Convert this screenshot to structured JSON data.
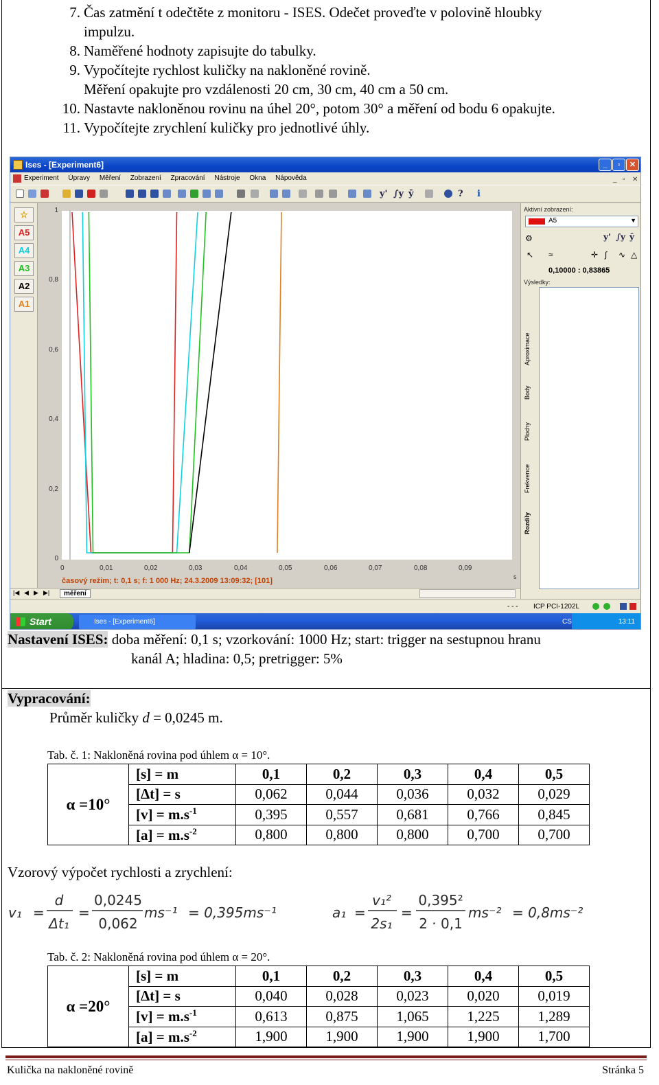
{
  "steps": [
    {
      "num": "7.",
      "text": "Čas zatmění t odečtěte z monitoru - ISES. Odečet proveďte v polovině hloubky"
    },
    {
      "num": "",
      "text": "impulzu."
    },
    {
      "num": "8.",
      "text": "Naměřené hodnoty zapisujte do tabulky."
    },
    {
      "num": "9.",
      "text": "Vypočítejte rychlost kuličky na nakloněné rovině."
    },
    {
      "num": "",
      "text": "Měření opakujte pro vzdálenosti 20 cm, 30 cm, 40 cm a 50 cm."
    },
    {
      "num": "10.",
      "text": "Nastavte nakloněnou rovinu na úhel 20°, potom 30° a měření od bodu 6 opakujte."
    },
    {
      "num": "11.",
      "text": "Vypočítejte zrychlení kuličky pro jednotlivé úhly."
    }
  ],
  "screenshot": {
    "title": "Ises - [Experiment6]",
    "menu": [
      "Experiment",
      "Úpravy",
      "Měření",
      "Zobrazení",
      "Zpracování",
      "Nástroje",
      "Okna",
      "Nápověda"
    ],
    "toolbar_text": [
      "y'",
      "∫y",
      "ȳ"
    ],
    "channels": [
      "A5",
      "A4",
      "A3",
      "A2",
      "A1"
    ],
    "channel_colors": [
      "#e02020",
      "#10d0e0",
      "#20c020",
      "#000000",
      "#e08020"
    ],
    "status_line": "časový režim; t: 0,1 s; f: 1 000 Hz; 24.3.2009 13:09:32; [101]",
    "tab_label": "měření",
    "x_unit": "s",
    "right_panel": {
      "active_label": "Aktivní zobrazení:",
      "active_value": "A5",
      "tool_text": [
        "y'",
        "∫y",
        "ȳ"
      ],
      "readout": "0,10000 : 0,83865",
      "results_label": "Výsledky:",
      "vertical_tabs": [
        "Aproximace",
        "Body",
        "Plochy",
        "Frekvence",
        "Rozdíly"
      ]
    },
    "status_bar": {
      "left": "- - -",
      "device": "ICP PCI-1202L"
    },
    "taskbar": {
      "start": "Start",
      "task": "Ises - [Experiment6]",
      "lang": "CS",
      "clock": "13:11"
    }
  },
  "chart_data": {
    "type": "line",
    "title": "",
    "xlabel": "",
    "ylabel": "",
    "x_unit": "s",
    "xlim": [
      0,
      0.1
    ],
    "ylim": [
      0,
      1
    ],
    "x_ticks": [
      "0",
      "0,01",
      "0,02",
      "0,03",
      "0,04",
      "0,05",
      "0,06",
      "0,07",
      "0,08",
      "0,09"
    ],
    "y_ticks": [
      "1",
      "0,8",
      "0,6",
      "0,4",
      "0,2",
      "0"
    ],
    "series": [
      {
        "name": "A5",
        "color": "#e02020",
        "points": [
          [
            0.0005,
            1
          ],
          [
            0.005,
            0
          ],
          [
            0.0245,
            0
          ],
          [
            0.0255,
            1
          ]
        ]
      },
      {
        "name": "A4",
        "color": "#10d0e0",
        "points": [
          [
            0.003,
            1
          ],
          [
            0.004,
            0
          ],
          [
            0.0255,
            0
          ],
          [
            0.0305,
            1
          ]
        ]
      },
      {
        "name": "A3",
        "color": "#20c020",
        "points": [
          [
            0.0045,
            1
          ],
          [
            0.0055,
            0
          ],
          [
            0.0285,
            0
          ],
          [
            0.0325,
            1
          ]
        ]
      },
      {
        "name": "A2",
        "color": "#000000",
        "points": [
          [
            0.0285,
            0
          ],
          [
            0.0385,
            1
          ]
        ]
      },
      {
        "name": "A1",
        "color": "#e08020",
        "points": [
          [
            0.0495,
            0
          ],
          [
            0.0505,
            1
          ]
        ]
      }
    ]
  },
  "settings": {
    "label": "Nastavení ISES:",
    "line1": "doba měření: 0,1 s; vzorkování: 1000 Hz; start: trigger na sestupnou hranu",
    "line2": "kanál A; hladina: 0,5;  pretrigger: 5%"
  },
  "processing": {
    "label": "Vypracování:",
    "diameter_prefix": "Průměr kuličky ",
    "diameter_var": "d",
    "diameter_value": " = 0,0245 m."
  },
  "table1": {
    "caption": "Tab. č. 1: Nakloněná rovina pod úhlem α = 10°.",
    "alpha": "α =10°",
    "header": [
      "0,1",
      "0,2",
      "0,3",
      "0,4",
      "0,5"
    ],
    "rows": [
      {
        "qty": "[s] = m",
        "values": [
          "0,1",
          "0,2",
          "0,3",
          "0,4",
          "0,5"
        ]
      },
      {
        "qty": "[Δt] = s",
        "values": [
          "0,062",
          "0,044",
          "0,036",
          "0,032",
          "0,029"
        ]
      },
      {
        "qty": "[v] = m.s",
        "exp": "-1",
        "values": [
          "0,395",
          "0,557",
          "0,681",
          "0,766",
          "0,845"
        ]
      },
      {
        "qty": "[a] = m.s",
        "exp": "-2",
        "values": [
          "0,800",
          "0,800",
          "0,800",
          "0,700",
          "0,700"
        ]
      }
    ]
  },
  "example_heading": "Vzorový výpočet rychlosti a zrychlení:",
  "formula_v": {
    "lhs": "v₁",
    "n1": "d",
    "d1": "Δt₁",
    "n2": "0,0245",
    "d2": "0,062",
    "unit": "ms⁻¹",
    "result": "= 0,395ms⁻¹"
  },
  "formula_a": {
    "lhs": "a₁",
    "n1": "v₁²",
    "d1": "2s₁",
    "n2": "0,395²",
    "d2": "2 · 0,1",
    "unit": "ms⁻²",
    "result": "= 0,8ms⁻²"
  },
  "table2": {
    "caption": "Tab. č. 2: Nakloněná rovina pod úhlem α = 20°.",
    "alpha": "α =20°",
    "rows": [
      {
        "qty": "[s] = m",
        "values": [
          "0,1",
          "0,2",
          "0,3",
          "0,4",
          "0,5"
        ]
      },
      {
        "qty": "[Δt] = s",
        "values": [
          "0,040",
          "0,028",
          "0,023",
          "0,020",
          "0,019"
        ]
      },
      {
        "qty": "[v] = m.s",
        "exp": "-1",
        "values": [
          "0,613",
          "0,875",
          "1,065",
          "1,225",
          "1,289"
        ]
      },
      {
        "qty": "[a] = m.s",
        "exp": "-2",
        "values": [
          "1,900",
          "1,900",
          "1,900",
          "1,900",
          "1,700"
        ]
      }
    ]
  },
  "footer": {
    "left": "Kulička na nakloněné rovině",
    "right": "Stránka 5"
  }
}
